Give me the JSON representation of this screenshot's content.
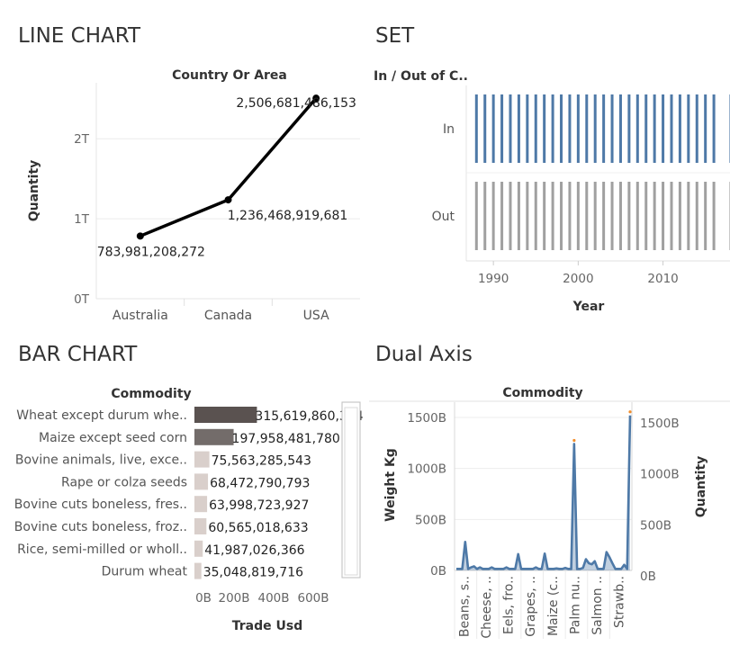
{
  "panels": {
    "line_title": "LINE CHART",
    "set_title": "SET",
    "bar_title": "BAR CHART",
    "dual_title": "Dual Axis"
  },
  "colors": {
    "line": "#000000",
    "set_in": "#4e79a7",
    "set_out": "#a0a0a0",
    "bar_dark": "#5a5250",
    "bar_light": "#d9cfcb",
    "dual_series": "#4e79a7",
    "dual_marker": "#f28e2b"
  },
  "chart_data": [
    {
      "id": "line",
      "type": "line",
      "header": "Country Or Area",
      "ylabel": "Quantity",
      "categories": [
        "Australia",
        "Canada",
        "USA"
      ],
      "values": [
        783981208272,
        1236468919681,
        2506681486153
      ],
      "value_labels": [
        "783,981,208,272",
        "1,236,468,919,681",
        "2,506,681,486,153"
      ],
      "yticks": [
        0,
        1000000000000,
        2000000000000
      ],
      "ytick_labels": [
        "0T",
        "1T",
        "2T"
      ],
      "ylim": [
        0,
        2700000000000
      ],
      "grid": true
    },
    {
      "id": "set",
      "type": "bar",
      "header": "In / Out of C..",
      "xlabel": "Year",
      "rows": [
        "In",
        "Out"
      ],
      "in_years": [
        1988,
        1989,
        1990,
        1991,
        1992,
        1993,
        1994,
        1995,
        1996,
        1997,
        1998,
        1999,
        2000,
        2001,
        2002,
        2003,
        2004,
        2005,
        2006,
        2007,
        2008,
        2009,
        2010,
        2011,
        2012,
        2013,
        2014,
        2015,
        2016,
        2018
      ],
      "out_years": [
        1988,
        1989,
        1990,
        1991,
        1992,
        1993,
        1994,
        1995,
        1996,
        1997,
        1998,
        1999,
        2000,
        2001,
        2002,
        2003,
        2004,
        2005,
        2006,
        2007,
        2008,
        2009,
        2010,
        2011,
        2012,
        2013,
        2014,
        2015,
        2016,
        2018
      ],
      "xticks": [
        1990,
        2000,
        2010
      ],
      "xtick_labels": [
        "1990",
        "2000",
        "2010"
      ],
      "xlim": [
        1986.8,
        2017.9
      ]
    },
    {
      "id": "bar",
      "type": "bar",
      "orientation": "horizontal",
      "header": "Commodity",
      "xlabel": "Trade Usd",
      "categories": [
        "Wheat except durum whe..",
        "Maize except seed corn",
        "Bovine animals, live, exce..",
        "Rape or colza seeds",
        "Bovine cuts boneless, fres..",
        "Bovine cuts boneless, froz..",
        "Rice, semi-milled or wholl..",
        "Durum wheat"
      ],
      "values": [
        315619860334,
        197958481780,
        75563285543,
        68472790793,
        63998723927,
        60565018633,
        41987026366,
        35048819716
      ],
      "value_labels": [
        "315,619,860,334",
        "197,958,481,780",
        "75,563,285,543",
        "68,472,790,793",
        "63,998,723,927",
        "60,565,018,633",
        "41,987,026,366",
        "35,048,819,716"
      ],
      "xticks": [
        0,
        200000000000,
        400000000000,
        600000000000
      ],
      "xtick_labels": [
        "0B",
        "200B",
        "400B",
        "600B"
      ],
      "xlim": [
        0,
        700000000000
      ]
    },
    {
      "id": "dual",
      "type": "area",
      "header": "Commodity",
      "ylabel_left": "Weight Kg",
      "ylabel_right": "Quantity",
      "category_labels": [
        "Beans, s..",
        "Cheese, ..",
        "Eels, fro..",
        "Grapes, ..",
        "Maize (c..",
        "Palm nu..",
        "Salmon ..",
        "Strawb.."
      ],
      "yticks": [
        0,
        500000000000,
        1000000000000,
        1500000000000
      ],
      "ytick_labels": [
        "0B",
        "500B",
        "1000B",
        "1500B"
      ],
      "ylim": [
        0,
        1650000000000
      ],
      "n_points": 60,
      "baseline": 15000000000,
      "spikes": [
        {
          "at": 3,
          "value": 280000000000
        },
        {
          "at": 5,
          "value": 30000000000
        },
        {
          "at": 6,
          "value": 40000000000
        },
        {
          "at": 8,
          "value": 30000000000
        },
        {
          "at": 12,
          "value": 30000000000
        },
        {
          "at": 17,
          "value": 30000000000
        },
        {
          "at": 21,
          "value": 160000000000
        },
        {
          "at": 27,
          "value": 30000000000
        },
        {
          "at": 30,
          "value": 165000000000
        },
        {
          "at": 34,
          "value": 20000000000
        },
        {
          "at": 37,
          "value": 25000000000
        },
        {
          "at": 40,
          "value": 1240000000000
        },
        {
          "at": 43,
          "value": 25000000000
        },
        {
          "at": 44,
          "value": 110000000000
        },
        {
          "at": 45,
          "value": 70000000000
        },
        {
          "at": 46,
          "value": 60000000000
        },
        {
          "at": 47,
          "value": 90000000000
        },
        {
          "at": 51,
          "value": 180000000000
        },
        {
          "at": 52,
          "value": 130000000000
        },
        {
          "at": 53,
          "value": 70000000000
        },
        {
          "at": 57,
          "value": 55000000000
        },
        {
          "at": 59,
          "value": 1520000000000
        }
      ]
    }
  ]
}
